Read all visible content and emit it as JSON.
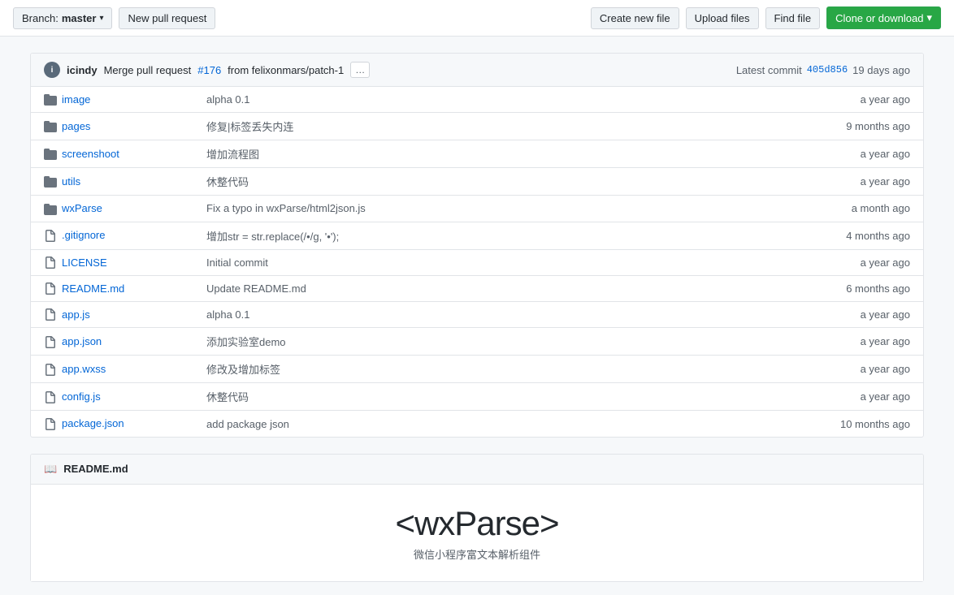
{
  "toolbar": {
    "branch_label": "Branch:",
    "branch_name": "master",
    "new_pull_request": "New pull request",
    "create_new_file": "Create new file",
    "upload_files": "Upload files",
    "find_file": "Find file",
    "clone_download": "Clone or download"
  },
  "commit_bar": {
    "user": "icindy",
    "message": "Merge pull request",
    "pr_number": "#176",
    "pr_from": "from felixonmars/patch-1",
    "latest_commit_label": "Latest commit",
    "commit_hash": "405d856",
    "commit_time": "19 days ago"
  },
  "files": [
    {
      "type": "folder",
      "name": "image",
      "description": "alpha 0.1",
      "time": "a year ago"
    },
    {
      "type": "folder",
      "name": "pages",
      "description": "修复|标签丢失内连",
      "time": "9 months ago"
    },
    {
      "type": "folder",
      "name": "screenshoot",
      "description": "增加流程图",
      "time": "a year ago"
    },
    {
      "type": "folder",
      "name": "utils",
      "description": "休整代码",
      "time": "a year ago"
    },
    {
      "type": "folder",
      "name": "wxParse",
      "description": "Fix a typo in wxParse/html2json.js",
      "time": "a month ago"
    },
    {
      "type": "file",
      "name": ".gitignore",
      "description": "增加str = str.replace(/&#8226;/g, '•');",
      "time": "4 months ago"
    },
    {
      "type": "file",
      "name": "LICENSE",
      "description": "Initial commit",
      "time": "a year ago"
    },
    {
      "type": "file",
      "name": "README.md",
      "description": "Update README.md",
      "time": "6 months ago"
    },
    {
      "type": "file",
      "name": "app.js",
      "description": "alpha 0.1",
      "time": "a year ago"
    },
    {
      "type": "file",
      "name": "app.json",
      "description": "添加实验室demo",
      "time": "a year ago"
    },
    {
      "type": "file",
      "name": "app.wxss",
      "description": "修改及增加标签",
      "time": "a year ago"
    },
    {
      "type": "file",
      "name": "config.js",
      "description": "休整代码",
      "time": "a year ago"
    },
    {
      "type": "file",
      "name": "package.json",
      "description": "add package json",
      "time": "10 months ago"
    }
  ],
  "readme": {
    "header": "README.md",
    "title_prefix": "<wxParse",
    "title_highlight": ">",
    "title_full": "<wxParse>",
    "subtitle": "微信小程序富文本解析组件"
  }
}
